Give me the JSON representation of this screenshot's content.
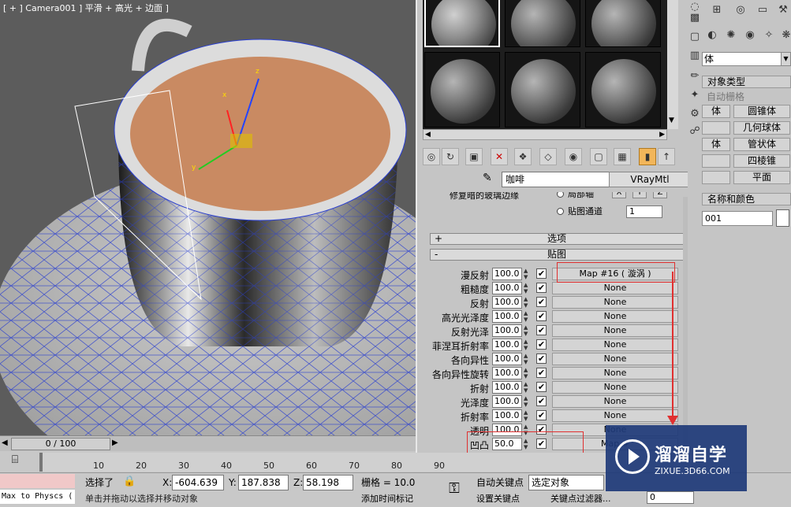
{
  "viewport": {
    "label": "[ + ] Camera001 ] 平滑 + 高光 + 边面 ]",
    "gizmo_axes": [
      "x",
      "y",
      "z"
    ]
  },
  "material_editor": {
    "material_name": "咖啡",
    "material_type": "VRayMtl",
    "partial_label_1": "修复暗的玻璃边缘",
    "radio_local_axis": "局部轴",
    "radio_map_channel": "贴图通道",
    "axis_x": "X",
    "axis_y": "Y",
    "axis_z": "Z",
    "map_channel_value": "1",
    "rollout_options": "选项",
    "rollout_maps": "贴图",
    "rollout_options_sign": "+",
    "rollout_maps_sign": "-",
    "maps": [
      {
        "label": "漫反射",
        "amount": "100.0",
        "checked": true,
        "map": "Map #16 ( 漩涡 )"
      },
      {
        "label": "粗糙度",
        "amount": "100.0",
        "checked": true,
        "map": "None"
      },
      {
        "label": "反射",
        "amount": "100.0",
        "checked": true,
        "map": "None"
      },
      {
        "label": "高光光泽度",
        "amount": "100.0",
        "checked": true,
        "map": "None"
      },
      {
        "label": "反射光泽",
        "amount": "100.0",
        "checked": true,
        "map": "None"
      },
      {
        "label": "菲涅耳折射率",
        "amount": "100.0",
        "checked": true,
        "map": "None"
      },
      {
        "label": "各向异性",
        "amount": "100.0",
        "checked": true,
        "map": "None"
      },
      {
        "label": "各向异性旋转",
        "amount": "100.0",
        "checked": true,
        "map": "None"
      },
      {
        "label": "折射",
        "amount": "100.0",
        "checked": true,
        "map": "None"
      },
      {
        "label": "光泽度",
        "amount": "100.0",
        "checked": true,
        "map": "None"
      },
      {
        "label": "折射率",
        "amount": "100.0",
        "checked": true,
        "map": "None"
      },
      {
        "label": "透明",
        "amount": "100.0",
        "checked": true,
        "map": "None"
      },
      {
        "label": "凹凸",
        "amount": "50.0",
        "checked": true,
        "map": "Map #"
      }
    ]
  },
  "command_panel": {
    "dropdown": "体",
    "object_type_header": "对象类型",
    "auto_grid": "自动栅格",
    "buttons": [
      {
        "left": "体",
        "right": "圆锥体"
      },
      {
        "left": "",
        "right": "几何球体"
      },
      {
        "left": "体",
        "right": "管状体"
      },
      {
        "left": "",
        "right": "四棱锥"
      },
      {
        "left": "",
        "right": "平面"
      }
    ],
    "name_color_header": "名称和颜色",
    "name_value": "001"
  },
  "timeline": {
    "slider": "0 / 100",
    "ticks": [
      "10",
      "20",
      "30",
      "40",
      "50",
      "60",
      "70",
      "80",
      "90"
    ]
  },
  "status": {
    "selected": "选择了",
    "x_label": "X:",
    "x_value": "-604.639",
    "y_label": "Y:",
    "y_value": "187.838",
    "z_label": "Z:",
    "z_value": "58.198",
    "grid": "栅格 = 10.0",
    "auto_key": "自动关键点",
    "selected_object": "选定对象",
    "set_key": "设置关键点",
    "key_filters": "关键点过滤器...",
    "frame_value": "0",
    "hint": "单击并拖动以选择并移动对象",
    "add_time_tag": "添加时间标记",
    "script_label": "Max to Physcs ("
  },
  "watermark": {
    "title": "溜溜自学",
    "url": "ZIXUE.3D66.COM"
  }
}
